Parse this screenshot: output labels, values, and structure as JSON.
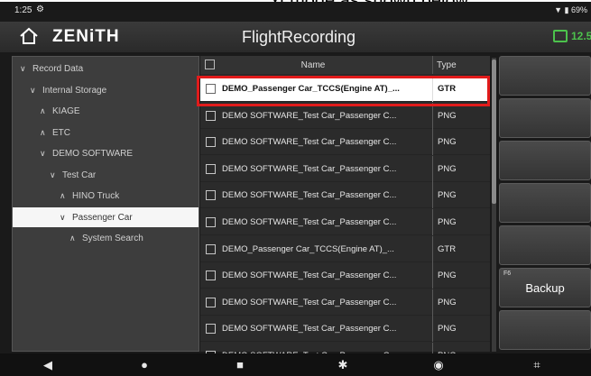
{
  "caption": "xt mode as shown below.",
  "status_bar": {
    "time": "1:25",
    "gear_icon": "gear-icon",
    "right": "▼ ▮ 69%"
  },
  "app_bar": {
    "brand": "ZENiTH",
    "title": "FlightRecording",
    "battery_text": "12.5"
  },
  "tree": [
    {
      "label": "Record Data",
      "chev": "∨",
      "indent": 0,
      "selected": false
    },
    {
      "label": "Internal Storage",
      "chev": "∨",
      "indent": 1,
      "selected": false
    },
    {
      "label": "KIAGE",
      "chev": "∧",
      "indent": 2,
      "selected": false
    },
    {
      "label": "ETC",
      "chev": "∧",
      "indent": 2,
      "selected": false
    },
    {
      "label": "DEMO SOFTWARE",
      "chev": "∨",
      "indent": 2,
      "selected": false
    },
    {
      "label": "Test Car",
      "chev": "∨",
      "indent": 3,
      "selected": false
    },
    {
      "label": "HINO Truck",
      "chev": "∧",
      "indent": 4,
      "selected": false
    },
    {
      "label": "Passenger Car",
      "chev": "∨",
      "indent": 4,
      "selected": true
    },
    {
      "label": "System Search",
      "chev": "∧",
      "indent": 5,
      "selected": false
    }
  ],
  "table": {
    "headers": {
      "name": "Name",
      "type": "Type"
    },
    "rows": [
      {
        "name": "DEMO_Passenger Car_TCCS(Engine AT)_...",
        "type": "GTR",
        "highlight": true
      },
      {
        "name": "DEMO SOFTWARE_Test Car_Passenger C...",
        "type": "PNG",
        "highlight": false
      },
      {
        "name": "DEMO SOFTWARE_Test Car_Passenger C...",
        "type": "PNG",
        "highlight": false
      },
      {
        "name": "DEMO SOFTWARE_Test Car_Passenger C...",
        "type": "PNG",
        "highlight": false
      },
      {
        "name": "DEMO SOFTWARE_Test Car_Passenger C...",
        "type": "PNG",
        "highlight": false
      },
      {
        "name": "DEMO SOFTWARE_Test Car_Passenger C...",
        "type": "PNG",
        "highlight": false
      },
      {
        "name": "DEMO_Passenger Car_TCCS(Engine AT)_...",
        "type": "GTR",
        "highlight": false
      },
      {
        "name": "DEMO SOFTWARE_Test Car_Passenger C...",
        "type": "PNG",
        "highlight": false
      },
      {
        "name": "DEMO SOFTWARE_Test Car_Passenger C...",
        "type": "PNG",
        "highlight": false
      },
      {
        "name": "DEMO SOFTWARE_Test Car_Passenger C...",
        "type": "PNG",
        "highlight": false
      },
      {
        "name": "DEMO SOFTWARE_Test Car_Passenger C...",
        "type": "PNG",
        "highlight": false
      }
    ]
  },
  "side_buttons": [
    {
      "fkey": "",
      "label": ""
    },
    {
      "fkey": "",
      "label": ""
    },
    {
      "fkey": "",
      "label": ""
    },
    {
      "fkey": "",
      "label": ""
    },
    {
      "fkey": "",
      "label": ""
    },
    {
      "fkey": "F6",
      "label": "Backup"
    },
    {
      "fkey": "",
      "label": ""
    }
  ],
  "nav_bar": [
    "back-icon",
    "home-dot-icon",
    "recents-icon",
    "settings-icon",
    "browser-icon",
    "screenshot-icon"
  ],
  "colors": {
    "highlight_border": "#e21b1b",
    "battery": "#4cc24c",
    "selected_tree_bg": "#f6f6f6"
  }
}
